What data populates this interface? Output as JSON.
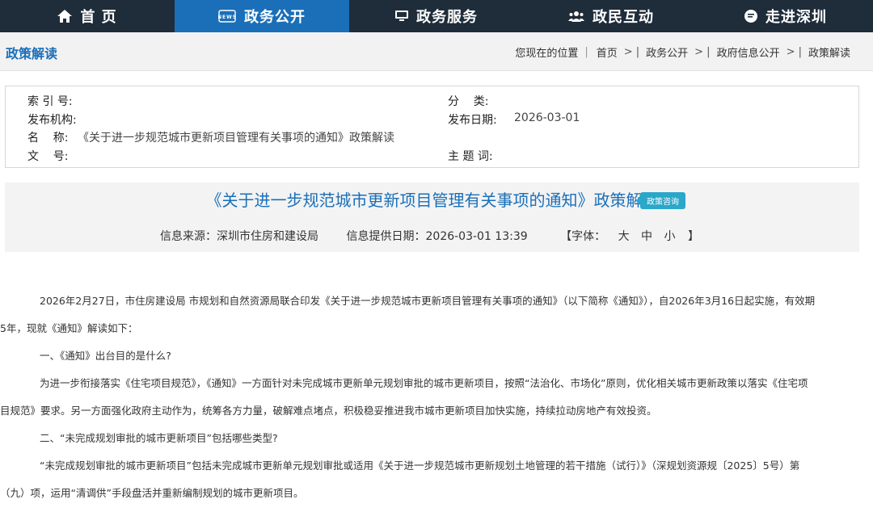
{
  "nav": {
    "items": [
      {
        "label": "首 页",
        "icon": "home-icon"
      },
      {
        "label": "政务公开",
        "icon": "news-icon",
        "active": true
      },
      {
        "label": "政务服务",
        "icon": "monitor-icon"
      },
      {
        "label": "政民互动",
        "icon": "people-icon"
      },
      {
        "label": "走进深圳",
        "icon": "chat-icon"
      }
    ],
    "colors": {
      "bar": "#1f2c3a",
      "active": "#1a6fb8"
    }
  },
  "crumbbar": {
    "title": "政策解读",
    "location_label": "您现在的位置",
    "crumbs": [
      "首页",
      "政务公开",
      "政府信息公开",
      "政策解读"
    ]
  },
  "meta": {
    "index_label": "索 引 号:",
    "index_value": "",
    "org_label": "发布机构:",
    "org_value": "",
    "name_label": "名    称:",
    "name_value": "《关于进一步规范城市更新项目管理有关事项的通知》政策解读",
    "docno_label": "文    号:",
    "docno_value": "",
    "category_label": "分    类:",
    "category_value": "",
    "date_label": "发布日期:",
    "date_value": "2026-03-01",
    "keyword_label": "主 题 词:",
    "keyword_value": ""
  },
  "doc": {
    "title": "《关于进一步规范城市更新项目管理有关事项的通知》政策解读",
    "badge": "政策咨询",
    "source": "信息来源：深圳市住房和建设局",
    "provided": "信息提供日期：2026-03-01 13:39",
    "font_label": "【字体：",
    "font_big": "大",
    "font_mid": "中",
    "font_small": "小",
    "font_end": "】"
  },
  "article": {
    "p1": "2026年2月27日，市住房建设局 市规划和自然资源局联合印发《关于进一步规范城市更新项目管理有关事项的通知》（以下简称《通知》），自2026年3月16日起实施，有效期",
    "p1b": "5年，现就《通知》解读如下：",
    "h1": "一、《通知》出台目的是什么?",
    "p2": "为进一步衔接落实《住宅项目规范》，《通知》一方面针对未完成城市更新单元规划审批的城市更新项目，按照“法治化、市场化”原则，优化相关城市更新政策以落实《住宅项",
    "p2b": "目规范》要求。另一方面强化政府主动作为，统筹各方力量，破解难点堵点，积极稳妥推进我市城市更新项目加快实施，持续拉动房地产有效投资。",
    "h2": "二、“未完成规划审批的城市更新项目”包括哪些类型?",
    "p3": "“未完成规划审批的城市更新项目”包括未完成城市更新单元规划审批或适用《关于进一步规范城市更新规划土地管理的若干措施（试行）》（深规划资源规〔2025〕5号）第",
    "p3b": "（九）项，运用“清调供”手段盘活并重新编制规划的城市更新项目。"
  }
}
